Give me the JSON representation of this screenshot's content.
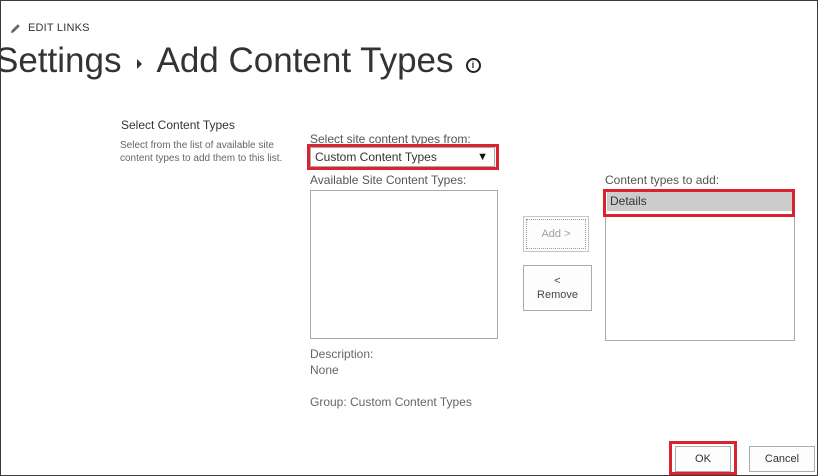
{
  "header": {
    "edit_links": "EDIT LINKS",
    "breadcrumb_parent": "Settings",
    "page_title": "Add Content Types",
    "info_glyph": "i"
  },
  "section": {
    "heading": "Select Content Types",
    "description": "Select from the list of available site content types to add them to this list."
  },
  "form": {
    "select_label": "Select site content types from:",
    "select_value": "Custom Content Types",
    "available_label": "Available Site Content Types:",
    "available_items": [],
    "add_button": "Add >",
    "remove_arrow": "<",
    "remove_label": "Remove",
    "toadd_label": "Content types to add:",
    "toadd_items": [
      "Details"
    ],
    "description_label": "Description:",
    "description_value": "None",
    "group_text": "Group: Custom Content Types"
  },
  "footer": {
    "ok": "OK",
    "cancel": "Cancel"
  },
  "colors": {
    "highlight": "#d9232f",
    "selected_item_bg": "#cccccc"
  },
  "icons": {
    "edit": "pencil-icon",
    "breadcrumb_separator": "triangle-right-icon",
    "info": "info-icon",
    "dropdown": "triangle-down-icon"
  }
}
